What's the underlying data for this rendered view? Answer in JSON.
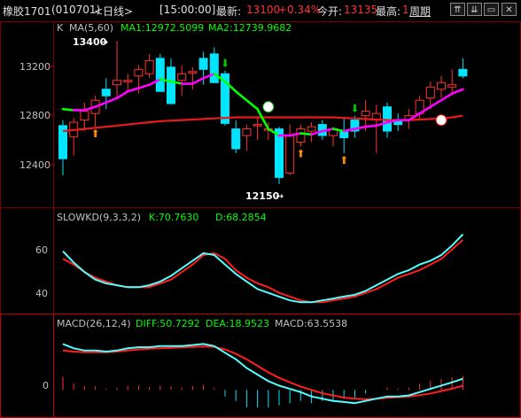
{
  "title": {
    "symbol": "橡胶1701",
    "code": "(010701)",
    "period": "<日线>",
    "time": "[15:00:00]",
    "latest_label": "最新:",
    "latest_value": "13100",
    "change": "+0.34%",
    "open_label": "今开:",
    "open_value": "13135",
    "high_label": "最高:",
    "high_value": "1",
    "period_button": "周期"
  },
  "window_buttons": [
    {
      "name": "collapse",
      "icon": "double-up-icon",
      "glyph": "⇈"
    },
    {
      "name": "expand",
      "icon": "double-down-icon",
      "glyph": "⇊"
    },
    {
      "name": "restore",
      "icon": "restore-icon",
      "glyph": "▭"
    },
    {
      "name": "close",
      "icon": "close-icon",
      "glyph": "✕"
    }
  ],
  "colors": {
    "background": "#000000",
    "up": "#ff3232",
    "down": "#00e5ff",
    "ma1": "#ff00ff",
    "ma2": "#00ff00",
    "kd_k": "#54ffff",
    "kd_d": "#ff1e1e",
    "diff": "#54ffff",
    "dea": "#ff1e1e",
    "long_line": "#e8191f",
    "label_white": "#ffffff",
    "label_green": "#00ff00"
  },
  "main_pane": {
    "label": "K",
    "ma_label": "MA(5,60)",
    "ma1_label": "MA1:12972.5099",
    "ma2_label": "MA2:12739.9682",
    "ticks": [
      "13200",
      "12800",
      "12400"
    ],
    "high_annotation": "13400",
    "low_annotation": "12150"
  },
  "kd_pane": {
    "label": "SLOWKD(9,3,3,2)",
    "k_label": "K:70.7630",
    "d_label": "D:68.2854",
    "ticks": [
      "60",
      "40"
    ]
  },
  "macd_pane": {
    "label": "MACD(26,12,4)",
    "diff_label": "DIFF:50.7292",
    "dea_label": "DEA:18.9523",
    "macd_label": "MACD:63.5538",
    "ticks": [
      "0"
    ]
  },
  "chart_data": [
    {
      "type": "candlestick",
      "title": "K MA(5,60)",
      "ylim": [
        11950,
        13500
      ],
      "ticks": [
        12400,
        12800,
        13200
      ],
      "candles": [
        {
          "o": 12650,
          "h": 12700,
          "l": 12200,
          "c": 12350
        },
        {
          "o": 12550,
          "h": 12720,
          "l": 12380,
          "c": 12680
        },
        {
          "o": 12700,
          "h": 12860,
          "l": 12600,
          "c": 12780
        },
        {
          "o": 12760,
          "h": 12920,
          "l": 12640,
          "c": 12880
        },
        {
          "o": 12980,
          "h": 13080,
          "l": 12800,
          "c": 12920
        },
        {
          "o": 13020,
          "h": 13420,
          "l": 12900,
          "c": 13060
        },
        {
          "o": 13060,
          "h": 13120,
          "l": 12960,
          "c": 13060
        },
        {
          "o": 13100,
          "h": 13200,
          "l": 12940,
          "c": 13160
        },
        {
          "o": 13120,
          "h": 13300,
          "l": 13080,
          "c": 13240
        },
        {
          "o": 13260,
          "h": 13300,
          "l": 12980,
          "c": 12960
        },
        {
          "o": 13180,
          "h": 13260,
          "l": 12840,
          "c": 12850
        },
        {
          "o": 13060,
          "h": 13200,
          "l": 12920,
          "c": 13120
        },
        {
          "o": 13140,
          "h": 13180,
          "l": 12980,
          "c": 13140
        },
        {
          "o": 13260,
          "h": 13320,
          "l": 13020,
          "c": 13160
        },
        {
          "o": 13300,
          "h": 13360,
          "l": 13080,
          "c": 13040
        },
        {
          "o": 13120,
          "h": 13150,
          "l": 12650,
          "c": 12670
        },
        {
          "o": 12620,
          "h": 12700,
          "l": 12400,
          "c": 12440
        },
        {
          "o": 12560,
          "h": 12660,
          "l": 12420,
          "c": 12620
        },
        {
          "o": 12650,
          "h": 12720,
          "l": 12520,
          "c": 12660
        },
        {
          "o": 12620,
          "h": 12680,
          "l": 12520,
          "c": 12620
        },
        {
          "o": 12620,
          "h": 12640,
          "l": 12120,
          "c": 12180
        },
        {
          "o": 12220,
          "h": 12660,
          "l": 12200,
          "c": 12560
        },
        {
          "o": 12500,
          "h": 12660,
          "l": 12460,
          "c": 12620
        },
        {
          "o": 12600,
          "h": 12680,
          "l": 12500,
          "c": 12640
        },
        {
          "o": 12660,
          "h": 12700,
          "l": 12520,
          "c": 12560
        },
        {
          "o": 12560,
          "h": 12640,
          "l": 12460,
          "c": 12620
        },
        {
          "o": 12600,
          "h": 12720,
          "l": 12400,
          "c": 12540
        },
        {
          "o": 12700,
          "h": 12740,
          "l": 12540,
          "c": 12600
        },
        {
          "o": 12740,
          "h": 12880,
          "l": 12600,
          "c": 12780
        },
        {
          "o": 12700,
          "h": 12840,
          "l": 12400,
          "c": 12760
        },
        {
          "o": 12820,
          "h": 12860,
          "l": 12540,
          "c": 12600
        },
        {
          "o": 12700,
          "h": 12760,
          "l": 12600,
          "c": 12660
        },
        {
          "o": 12700,
          "h": 12800,
          "l": 12620,
          "c": 12740
        },
        {
          "o": 12760,
          "h": 12920,
          "l": 12700,
          "c": 12880
        },
        {
          "o": 12900,
          "h": 13050,
          "l": 12800,
          "c": 13000
        },
        {
          "o": 12980,
          "h": 13100,
          "l": 12900,
          "c": 13040
        },
        {
          "o": 13000,
          "h": 13160,
          "l": 12940,
          "c": 13020
        },
        {
          "o": 13160,
          "h": 13260,
          "l": 13080,
          "c": 13100
        }
      ],
      "ma1": [
        12800,
        12790,
        12790,
        12820,
        12860,
        12900,
        12960,
        12990,
        13020,
        13070,
        13050,
        13030,
        13030,
        13080,
        13120,
        13050,
        12960,
        12880,
        12800,
        12620,
        12560,
        12560,
        12580,
        12570,
        12600,
        12620,
        12600,
        12620,
        12640,
        12650,
        12680,
        12700,
        12700,
        12760,
        12820,
        12880,
        12940,
        12980
      ],
      "ma2": [
        12600,
        12610,
        12620,
        12630,
        12640,
        12650,
        12660,
        12670,
        12680,
        12690,
        12695,
        12700,
        12705,
        12710,
        12715,
        12720,
        12725,
        12725,
        12725,
        12725,
        12725,
        12725,
        12725,
        12725,
        12725,
        12725,
        12720,
        12715,
        12710,
        12705,
        12700,
        12700,
        12700,
        12705,
        12710,
        12715,
        12725,
        12740
      ]
    },
    {
      "type": "line",
      "title": "SLOWKD(9,3,3,2)",
      "ylim": [
        30,
        75
      ],
      "ticks": [
        40,
        60
      ],
      "series": [
        {
          "name": "K",
          "values": [
            62,
            56,
            51,
            47,
            45,
            44,
            43,
            43,
            44,
            46,
            49,
            53,
            57,
            61,
            60,
            55,
            50,
            46,
            42,
            40,
            38,
            36,
            35,
            35,
            36,
            37,
            38,
            39,
            41,
            44,
            47,
            50,
            52,
            55,
            57,
            60,
            65,
            71
          ]
        },
        {
          "name": "D",
          "values": [
            58,
            55,
            51,
            48,
            46,
            44,
            43,
            43,
            43,
            45,
            47,
            51,
            55,
            60,
            61,
            58,
            52,
            48,
            45,
            43,
            40,
            38,
            36,
            35,
            35,
            36,
            37,
            38,
            40,
            42,
            45,
            48,
            50,
            52,
            55,
            58,
            63,
            68
          ]
        }
      ]
    },
    {
      "type": "line",
      "title": "MACD(26,12,4)",
      "ylim": [
        -120,
        260
      ],
      "ticks": [
        0
      ],
      "series": [
        {
          "name": "DIFF",
          "values": [
            210,
            190,
            180,
            180,
            175,
            180,
            190,
            195,
            195,
            200,
            200,
            200,
            205,
            210,
            200,
            170,
            140,
            100,
            70,
            40,
            20,
            5,
            -10,
            -30,
            -40,
            -50,
            -55,
            -60,
            -50,
            -40,
            -30,
            -30,
            -25,
            -10,
            5,
            20,
            35,
            51
          ]
        },
        {
          "name": "DEA",
          "values": [
            180,
            175,
            172,
            172,
            172,
            175,
            180,
            185,
            188,
            190,
            192,
            194,
            196,
            198,
            196,
            185,
            165,
            140,
            110,
            80,
            55,
            35,
            15,
            0,
            -15,
            -25,
            -35,
            -40,
            -42,
            -40,
            -36,
            -33,
            -30,
            -24,
            -16,
            -5,
            6,
            19
          ]
        }
      ]
    }
  ]
}
